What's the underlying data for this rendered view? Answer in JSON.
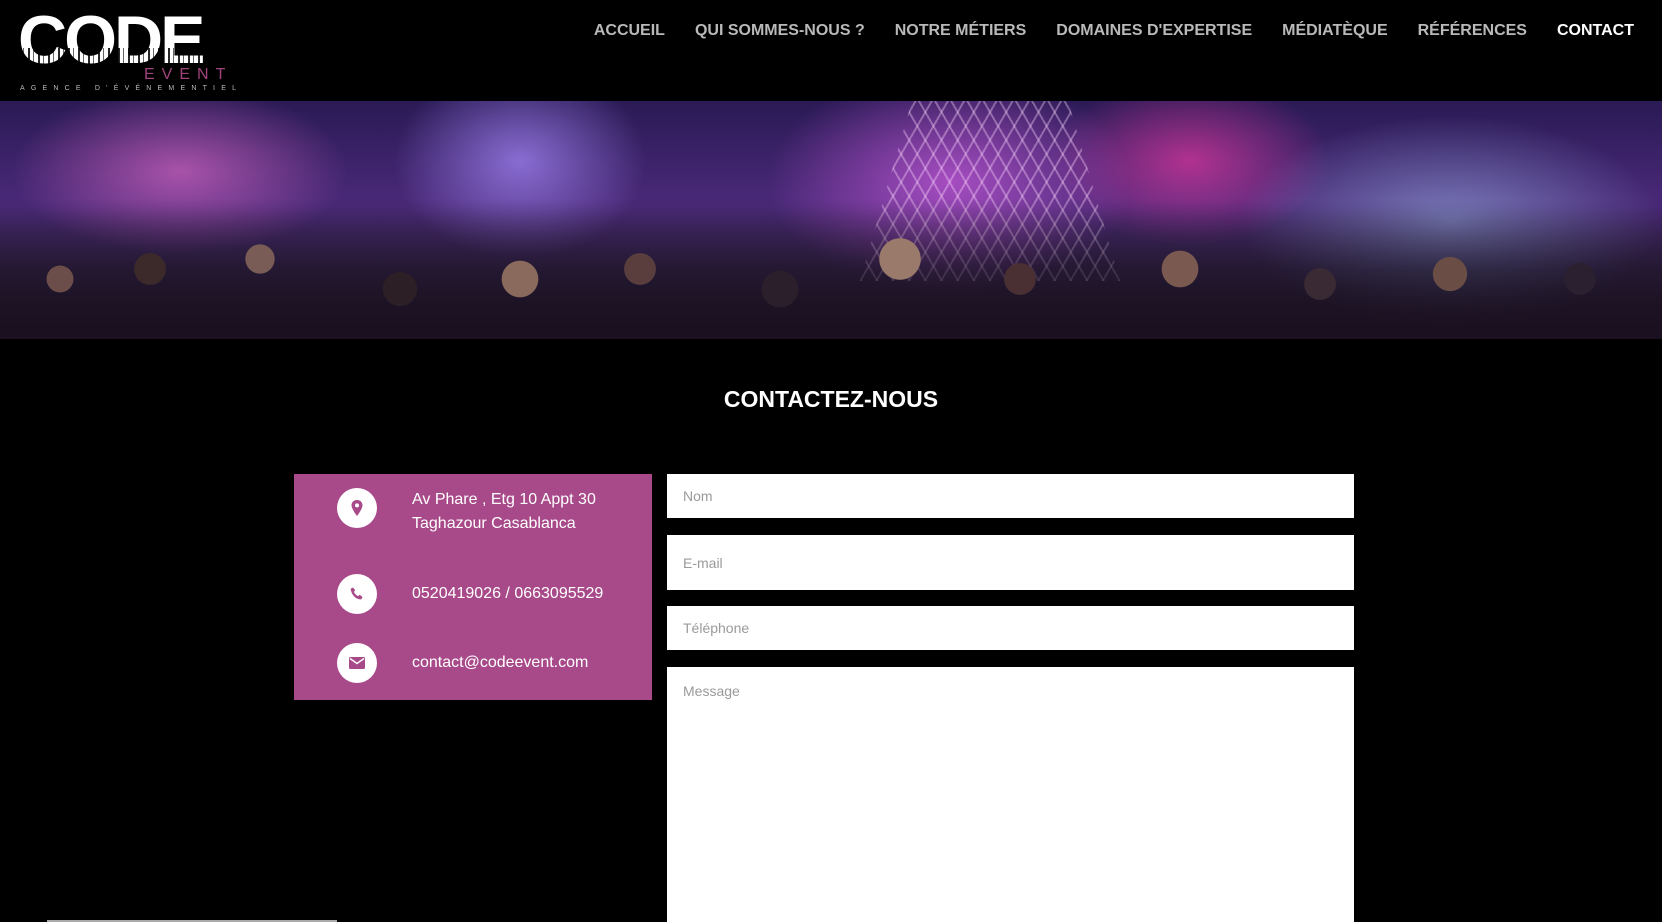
{
  "header": {
    "logo": {
      "main": "CODE",
      "event": "EVENT",
      "tagline": "AGENCE D'ÉVÉNEMENTIEL"
    },
    "nav": [
      {
        "label": "ACCUEIL",
        "active": false
      },
      {
        "label": "QUI SOMMES-NOUS ?",
        "active": false
      },
      {
        "label": "NOTRE MÉTIERS",
        "active": false
      },
      {
        "label": "DOMAINES D'EXPERTISE",
        "active": false
      },
      {
        "label": "MÉDIATÈQUE",
        "active": false
      },
      {
        "label": "RÉFÉRENCES",
        "active": false
      },
      {
        "label": "CONTACT",
        "active": true
      }
    ]
  },
  "banner": {
    "image_description_icon": "event-crowd-photo"
  },
  "contact": {
    "title": "CONTACTEZ-NOUS",
    "info": {
      "address_line1": "Av Phare , Etg 10 Appt 30",
      "address_line2": "Taghazour Casablanca",
      "phone": "0520419026 / 0663095529",
      "email": "contact@codeevent.com"
    },
    "form": {
      "name_placeholder": "Nom",
      "email_placeholder": "E-mail",
      "phone_placeholder": "Téléphone",
      "message_placeholder": "Message"
    }
  },
  "colors": {
    "accent": "#a84a8a",
    "background": "#000000",
    "nav_text": "#b9b9b9",
    "nav_active": "#ffffff"
  }
}
